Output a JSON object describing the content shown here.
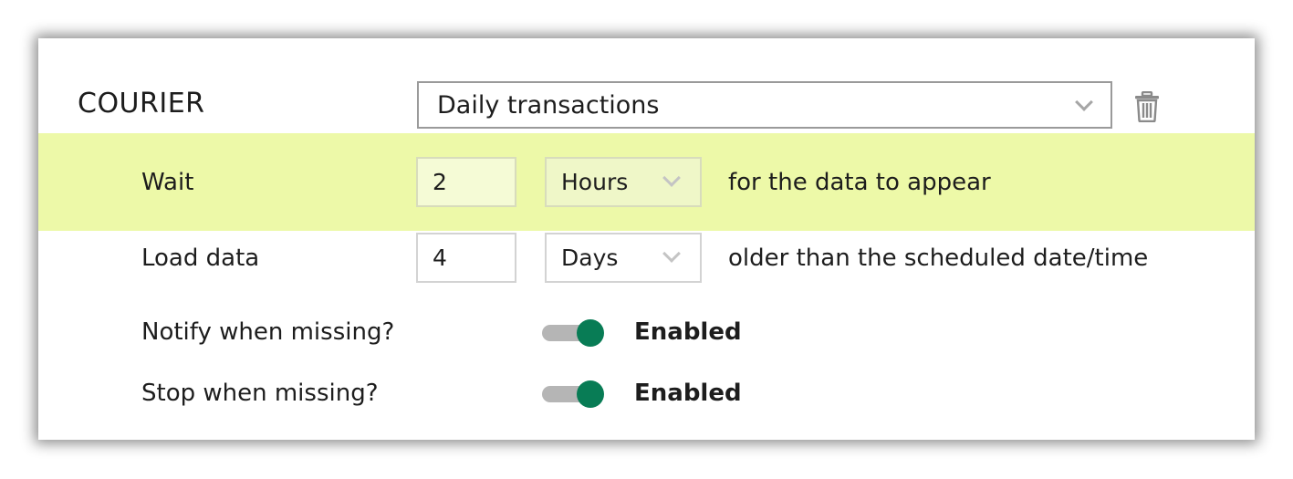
{
  "source": {
    "label": "COURIER",
    "selected": "Daily transactions"
  },
  "wait": {
    "label": "Wait",
    "value": "2",
    "unit": "Hours",
    "suffix": "for the data to appear"
  },
  "load": {
    "label": "Load data",
    "value": "4",
    "unit": "Days",
    "suffix": "older than the scheduled date/time"
  },
  "notify": {
    "label": "Notify when missing?",
    "enabled": true,
    "status": "Enabled"
  },
  "stop": {
    "label": "Stop when missing?",
    "enabled": true,
    "status": "Enabled"
  },
  "colors": {
    "highlight": "#edf9a8",
    "toggle_on": "#087c55",
    "toggle_track": "#b5b5b5"
  },
  "icons": {
    "delete": "trash-icon",
    "dropdown": "chevron-down-icon"
  }
}
